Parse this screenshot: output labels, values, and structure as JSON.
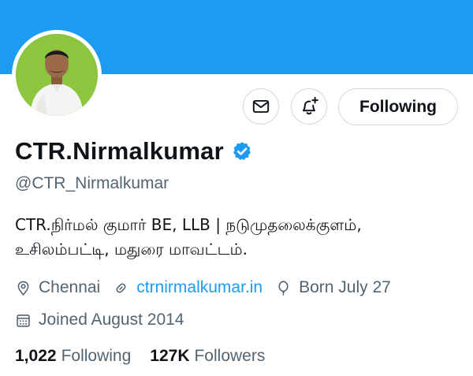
{
  "profile": {
    "display_name": "CTR.Nirmalkumar",
    "handle": "@CTR_Nirmalkumar",
    "bio_lines": [
      "CTR.நிர்மல் குமார் BE, LLB | நடுமுதலைக்குளம்,",
      "உசிலம்பட்டி, மதுரை மாவட்டம்."
    ],
    "verified": true
  },
  "actions": {
    "message_icon": "mail-icon",
    "notify_icon": "bell-plus-icon",
    "follow_label": "Following"
  },
  "meta": {
    "location": "Chennai",
    "website": "ctrnirmalkumar.in",
    "birthday": "Born July 27",
    "joined": "Joined August 2014"
  },
  "stats": {
    "following_count": "1,022",
    "following_label": "Following",
    "followers_count": "127K",
    "followers_label": "Followers"
  },
  "colors": {
    "banner": "#1d9bf0",
    "link": "#1d9bf0",
    "secondary_text": "#536471",
    "verified_badge": "#1d9bf0"
  }
}
